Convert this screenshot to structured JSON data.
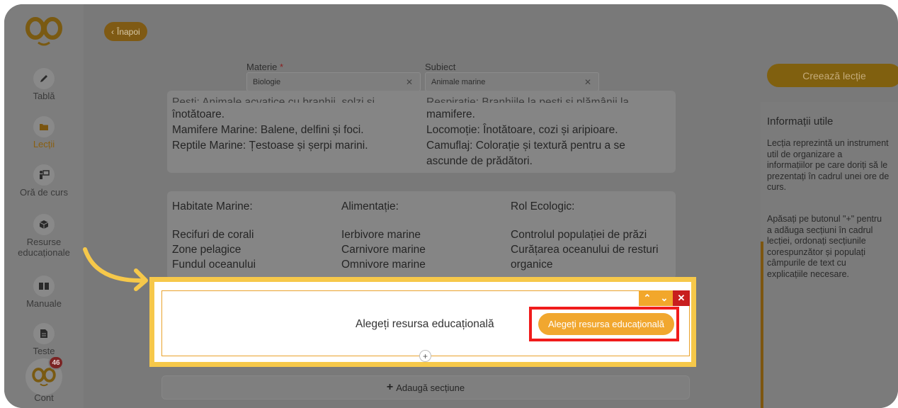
{
  "sidebar": {
    "items": [
      {
        "label": "Tablă",
        "icon": "pencil-icon"
      },
      {
        "label": "Lecții",
        "icon": "folder-icon"
      },
      {
        "label": "Oră de curs",
        "icon": "teacher-icon"
      },
      {
        "label": "Resurse\neducaționale",
        "icon": "cube-icon"
      },
      {
        "label": "Manuale",
        "icon": "book-icon"
      },
      {
        "label": "Teste",
        "icon": "document-icon"
      },
      {
        "label": "Cont",
        "icon": "avatar-icon"
      }
    ],
    "notification_count": "46"
  },
  "header": {
    "back_label": "Înapoi",
    "materie_label": "Materie",
    "materie_required": "*",
    "materie_value": "Biologie",
    "subiect_label": "Subiect",
    "subiect_value": "Animale marine"
  },
  "card1": {
    "col1": [
      "Pești: Animale acvatice cu branhii, solzi și",
      "înotătoare.",
      "Mamifere Marine: Balene, delfini și foci.",
      "Reptile Marine: Țestoase și șerpi marini."
    ],
    "col2": [
      "Respirație: Branhiile la pești și plămânii la",
      "mamifere.",
      "Locomoție: Înotătoare, cozi și aripioare.",
      "Camuflaj: Colorație și textură pentru a se",
      "ascunde de prădători."
    ]
  },
  "card2": {
    "col1": [
      "Habitate Marine:",
      "Recifuri de corali",
      "Zone pelagice",
      "Fundul oceanului"
    ],
    "col2": [
      "Alimentație:",
      "Ierbivore marine",
      "Carnivore marine",
      "Omnivore marine"
    ],
    "col3": [
      "Rol Ecologic:",
      "Controlul populației de prăzi",
      "Curățarea oceanului de resturi",
      "organice"
    ]
  },
  "section": {
    "label": "Alegeți resursa educațională",
    "button": "Alegeți resursa educațională",
    "controls": {
      "up": "⌃",
      "down": "⌄",
      "close": "✕"
    },
    "plus": "+"
  },
  "add_section_label": "Adaugă secțiune",
  "add_section_plus": "+",
  "right_panel": {
    "create_button": "Creează lecție",
    "info_title": "Informații utile",
    "para1": "Lecția reprezintă un instrument\nutil de organizare a\ninformațiilor pe care doriți să le\nprezentați în cadrul unei ore de\ncurs.",
    "para2": "Apăsați pe butonul \"+\" pentru\na adăuga secțiuni în cadrul\nlecției, ordonați secțiunile\ncorespunzător și populați\ncâmpurile de text cu\nexplicațiile necesare."
  },
  "colors": {
    "highlight": "#f6c84a",
    "accent": "#f1a72f",
    "red_box": "#f01c1c"
  }
}
